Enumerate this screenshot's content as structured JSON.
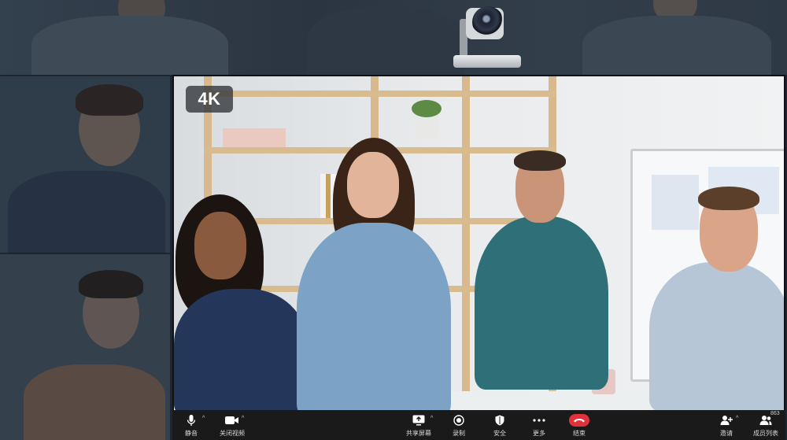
{
  "video": {
    "quality_badge": "4K"
  },
  "toolbar": {
    "mute_label": "静音",
    "video_label": "关闭视频",
    "share_label": "共享屏幕",
    "record_label": "录制",
    "security_label": "安全",
    "more_label": "更多",
    "end_label": "结束",
    "invite_label": "邀请",
    "participants_label": "成员列表",
    "participants_count": "863",
    "end_color": "#e0323a"
  },
  "icons": {
    "mic": "microphone-icon",
    "video": "video-camera-icon",
    "share": "share-screen-icon",
    "record": "record-icon",
    "security": "shield-icon",
    "more": "more-dots-icon",
    "end": "hang-up-icon",
    "invite": "add-user-icon",
    "participants": "users-icon"
  }
}
